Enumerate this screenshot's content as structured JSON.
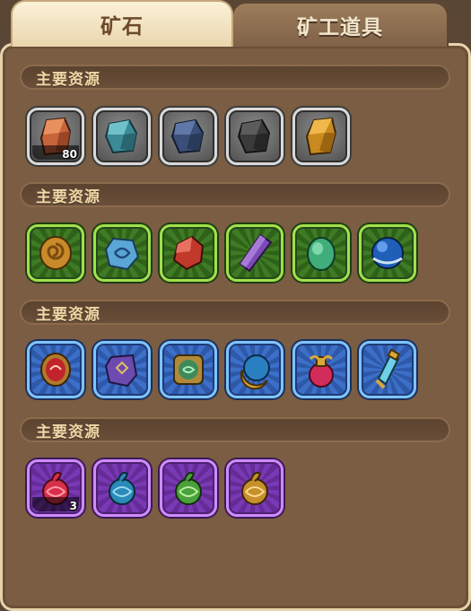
{
  "tabs": {
    "ore": "矿石",
    "tools": "矿工道具"
  },
  "sections": [
    {
      "title": "主要资源",
      "tier": "gray",
      "items": [
        {
          "icon": "orange-ore-icon",
          "count": "80"
        },
        {
          "icon": "teal-ore-icon",
          "count": ""
        },
        {
          "icon": "dark-blue-ore-icon",
          "count": ""
        },
        {
          "icon": "black-ore-icon",
          "count": ""
        },
        {
          "icon": "gold-ore-icon",
          "count": ""
        }
      ]
    },
    {
      "title": "主要资源",
      "tier": "green",
      "items": [
        {
          "icon": "amber-swirl-stone-icon",
          "count": ""
        },
        {
          "icon": "blue-rune-stone-icon",
          "count": ""
        },
        {
          "icon": "red-crystal-icon",
          "count": ""
        },
        {
          "icon": "purple-crystal-shard-icon",
          "count": ""
        },
        {
          "icon": "green-gem-icon",
          "count": ""
        },
        {
          "icon": "blue-orb-icon",
          "count": ""
        }
      ]
    },
    {
      "title": "主要资源",
      "tier": "blue",
      "items": [
        {
          "icon": "red-rune-amulet-icon",
          "count": ""
        },
        {
          "icon": "purple-rune-tablet-icon",
          "count": ""
        },
        {
          "icon": "green-rune-amulet-icon",
          "count": ""
        },
        {
          "icon": "moon-orb-icon",
          "count": ""
        },
        {
          "icon": "red-potion-icon",
          "count": ""
        },
        {
          "icon": "blue-potion-icon",
          "count": ""
        }
      ]
    },
    {
      "title": "主要资源",
      "tier": "purple",
      "items": [
        {
          "icon": "red-dragon-coil-icon",
          "count": "3"
        },
        {
          "icon": "blue-dragon-coil-icon",
          "count": ""
        },
        {
          "icon": "green-dragon-coil-icon",
          "count": ""
        },
        {
          "icon": "gold-dragon-coil-icon",
          "count": ""
        }
      ]
    }
  ]
}
